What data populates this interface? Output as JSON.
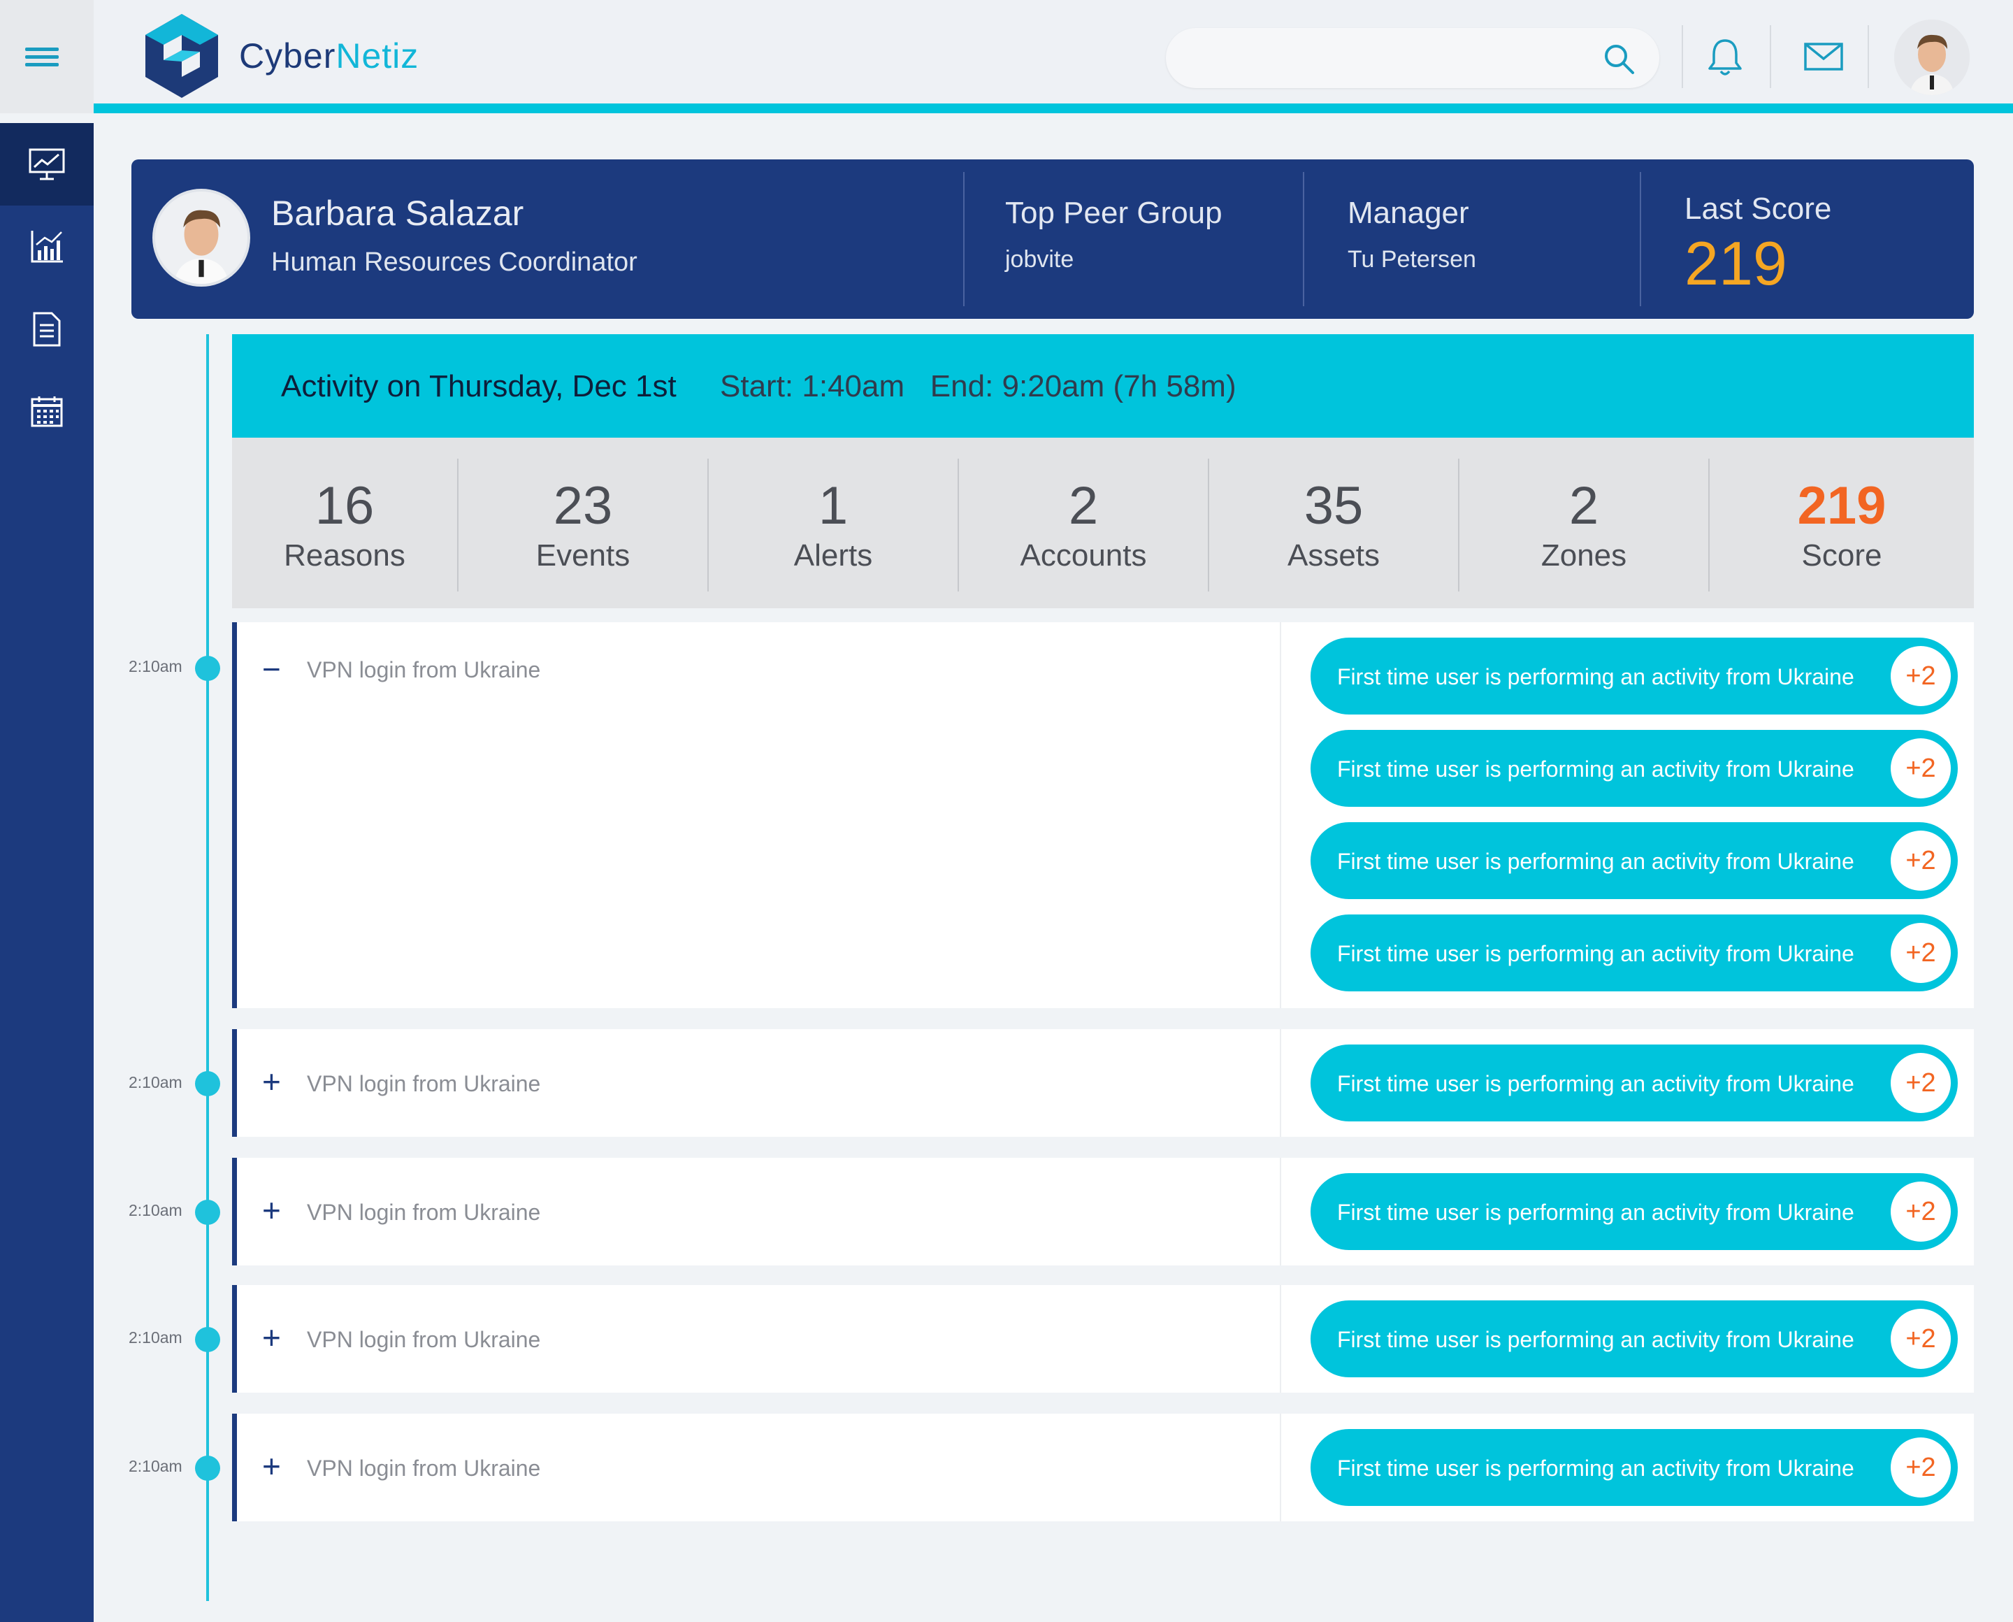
{
  "app": {
    "brand_part1": "Cyber",
    "brand_part2": "Netiz"
  },
  "search": {
    "placeholder": ""
  },
  "profile": {
    "name": "Barbara Salazar",
    "role": "Human Resources Coordinator",
    "peer_group_label": "Top Peer Group",
    "peer_group_value": "jobvite",
    "manager_label": "Manager",
    "manager_value": "Tu Petersen",
    "last_score_label": "Last Score",
    "last_score_value": "219"
  },
  "activity": {
    "title": "Activity on Thursday, Dec 1st",
    "time_range": "Start: 1:40am   End: 9:20am (7h 58m)"
  },
  "stats": [
    {
      "value": "16",
      "label": "Reasons"
    },
    {
      "value": "23",
      "label": "Events"
    },
    {
      "value": "1",
      "label": "Alerts"
    },
    {
      "value": "2",
      "label": "Accounts"
    },
    {
      "value": "35",
      "label": "Assets"
    },
    {
      "value": "2",
      "label": "Zones"
    },
    {
      "value": "219",
      "label": "Score"
    }
  ],
  "events": [
    {
      "time": "2:10am",
      "toggle": "−",
      "label": "VPN login from Ukraine",
      "expanded": true,
      "reasons": [
        {
          "text": "First time user is performing an activity from Ukraine",
          "badge": "+2"
        },
        {
          "text": "First time user is performing an activity from Ukraine",
          "badge": "+2"
        },
        {
          "text": "First time user is performing an activity from Ukraine",
          "badge": "+2"
        },
        {
          "text": "First time user is performing an activity from Ukraine",
          "badge": "+2"
        }
      ]
    },
    {
      "time": "2:10am",
      "toggle": "+",
      "label": "VPN login from Ukraine",
      "expanded": false,
      "reasons": [
        {
          "text": "First time user is performing an activity from Ukraine",
          "badge": "+2"
        }
      ]
    },
    {
      "time": "2:10am",
      "toggle": "+",
      "label": "VPN login from Ukraine",
      "expanded": false,
      "reasons": [
        {
          "text": "First time user is performing an activity from Ukraine",
          "badge": "+2"
        }
      ]
    },
    {
      "time": "2:10am",
      "toggle": "+",
      "label": "VPN login from Ukraine",
      "expanded": false,
      "reasons": [
        {
          "text": "First time user is performing an activity from Ukraine",
          "badge": "+2"
        }
      ]
    },
    {
      "time": "2:10am",
      "toggle": "+",
      "label": "VPN login from Ukraine",
      "expanded": false,
      "reasons": [
        {
          "text": "First time user is performing an activity from Ukraine",
          "badge": "+2"
        }
      ]
    }
  ],
  "colors": {
    "accent": "#00c4dc",
    "navy": "#1c3a7e",
    "score": "#f5a623",
    "badge": "#f26522"
  },
  "icons": [
    "menu-icon",
    "search-icon",
    "bell-icon",
    "mail-icon",
    "dashboard-icon",
    "analytics-icon",
    "report-icon",
    "calendar-icon"
  ]
}
